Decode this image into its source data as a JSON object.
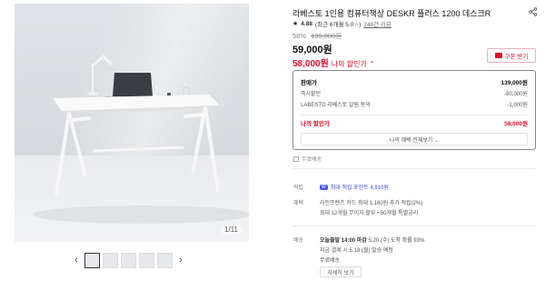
{
  "gallery": {
    "counter": "1/11",
    "prev_arrow": "‹",
    "next_arrow": "›"
  },
  "product": {
    "title": "라베스토 1인용 컴퓨터책상 DESKR 플러스 1200 데스크R",
    "rating": "4.88",
    "rating_note": "(최근 6개월 5.0☆)",
    "review_count": "248건 리뷰",
    "discount_rate": "58%",
    "original_price": "139,000원",
    "price": "59,000원",
    "my_price": "58,000원",
    "my_price_label": "나의 할인가 ⌃",
    "coupon_label": "쿠폰 받기"
  },
  "benefits": {
    "rows": [
      {
        "label": "판매가",
        "value": "139,000원"
      },
      {
        "label": "즉시할인",
        "value": "-80,000원"
      },
      {
        "label": "LABESTO 라베스토 알림 동의",
        "value": "-1,000원"
      }
    ],
    "my_price_label": "나의 할인가",
    "my_price_value": "58,000원",
    "all_benefits_button": "나의 혜택 전체보기 ⌄"
  },
  "free_shipping": "무료배송",
  "points": {
    "label": "적립",
    "badge": "W",
    "text": "최대 적립 포인트 4,910원"
  },
  "card_benefit": {
    "label": "혜택",
    "line1": "라인프렌즈 카드 최대 1,160원 추가 적립(2%)",
    "line2": "최대 12개월 무이자 할부 • 60개월 특별금리"
  },
  "delivery": {
    "label": "배송",
    "line1_strong": "오늘출발 14:00 마감",
    "line1_rest": "5.20.(수) 도착 확률 93%",
    "line2": "지금 결제 시 5.18.(월) 발송 예정",
    "line3": "무료배송",
    "map_button": "자세히 보기"
  },
  "colors": {
    "accent_red": "#e0112b",
    "point_blue": "#4b59e8"
  }
}
